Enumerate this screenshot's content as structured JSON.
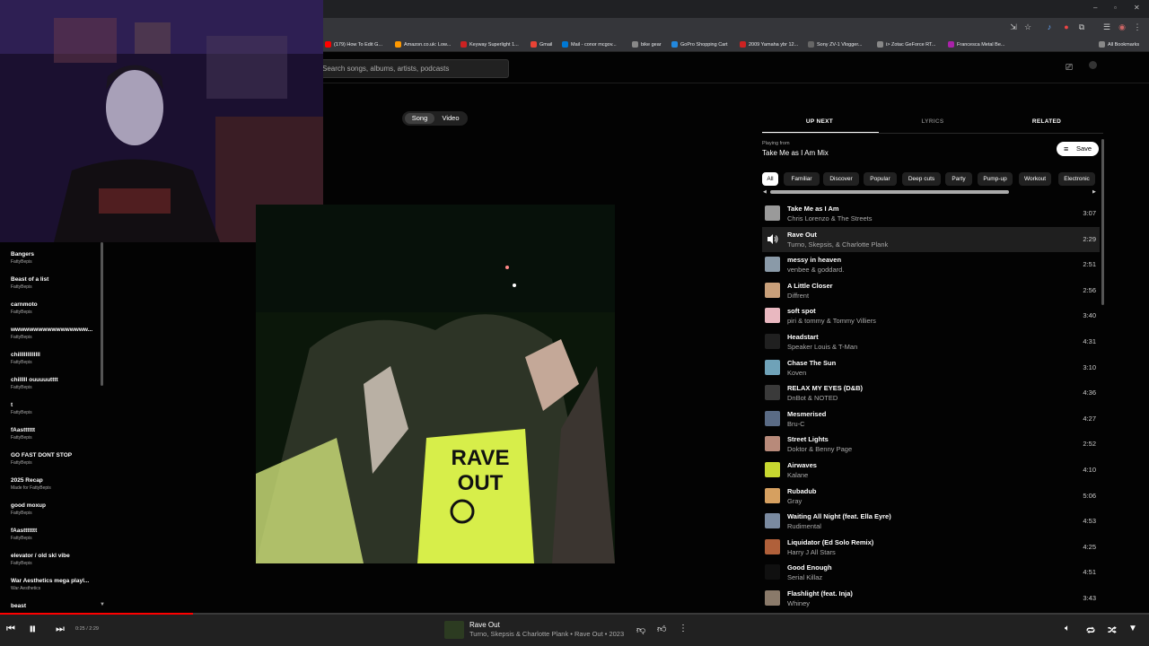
{
  "bookmarks": [
    {
      "label": "(179) How To Edit G...",
      "color": "#ff0000"
    },
    {
      "label": "Amazon.co.uk: Low...",
      "color": "#ff9900"
    },
    {
      "label": "Keyway Superlight 1...",
      "color": "#cc2222"
    },
    {
      "label": "Gmail",
      "color": "#ea4335"
    },
    {
      "label": "Mail - conor mcgov...",
      "color": "#0078d4"
    },
    {
      "label": "bike gear",
      "color": "#888888"
    },
    {
      "label": "GoPro Shopping Cart",
      "color": "#2288dd"
    },
    {
      "label": "2009 Yamaha ybr 12...",
      "color": "#cc2222"
    },
    {
      "label": "Sony ZV-1 Vlogger...",
      "color": "#666666"
    },
    {
      "label": "i> Zotac GeForce RT...",
      "color": "#888888"
    },
    {
      "label": "Francesca Metal Be...",
      "color": "#aa22aa"
    },
    {
      "label": "All Bookmarks",
      "color": "#888888"
    }
  ],
  "search": {
    "placeholder": "Search songs, albums, artists, podcasts"
  },
  "sidebar": {
    "playlists": [
      {
        "title": "Bangers",
        "sub": "FattyBepis"
      },
      {
        "title": "Beast of a list",
        "sub": "FattyBepis"
      },
      {
        "title": "carnmoto",
        "sub": "FattyBepis"
      },
      {
        "title": "wwwwwwwwwwwwwwwww...",
        "sub": "FattyBepis"
      },
      {
        "title": "chilllllllllllll",
        "sub": "FattyBepis"
      },
      {
        "title": "chilllll ouuuuutttt",
        "sub": "FattyBepis"
      },
      {
        "title": "t",
        "sub": "FattyBepis"
      },
      {
        "title": "fAastttttt",
        "sub": "FattyBepis"
      },
      {
        "title": "GO FAST DONT STOP",
        "sub": "FattyBepis"
      },
      {
        "title": "2025 Recap",
        "sub": "Made for FattyBepis"
      },
      {
        "title": "good moxup",
        "sub": "FattyBepis"
      },
      {
        "title": "fAasttttttt",
        "sub": "FattyBepis"
      },
      {
        "title": "elevator / old skl vibe",
        "sub": "FattyBepis"
      },
      {
        "title": "War Aesthetics mega playl...",
        "sub": "War Aesthetics"
      },
      {
        "title": "beast",
        "sub": ""
      }
    ]
  },
  "toggle": {
    "song": "Song",
    "video": "Video"
  },
  "art": {
    "sign_line1": "RAVE",
    "sign_line2": "OUT"
  },
  "panel": {
    "tabs": [
      "UP NEXT",
      "LYRICS",
      "RELATED"
    ],
    "playing_from": "Playing from",
    "mix_name": "Take Me as I Am Mix",
    "save_label": "Save",
    "chips": [
      "All",
      "Familiar",
      "Discover",
      "Popular",
      "Deep cuts",
      "Party",
      "Pump-up",
      "Workout",
      "Electronic"
    ],
    "queue": [
      {
        "title": "Take Me as I Am",
        "artist": "Chris Lorenzo & The Streets",
        "duration": "3:07",
        "color": "#9a9a9a"
      },
      {
        "title": "Rave Out",
        "artist": "Turno, Skepsis, & Charlotte Plank",
        "duration": "2:29",
        "color": "#2c3b21"
      },
      {
        "title": "messy in heaven",
        "artist": "venbee & goddard.",
        "duration": "2:51",
        "color": "#8a9aa8"
      },
      {
        "title": "A Little Closer",
        "artist": "Diffrent",
        "duration": "2:56",
        "color": "#c9a07a"
      },
      {
        "title": "soft spot",
        "artist": "piri & tommy & Tommy Villiers",
        "duration": "3:40",
        "color": "#e9b8c0"
      },
      {
        "title": "Headstart",
        "artist": "Speaker Louis & T-Man",
        "duration": "4:31",
        "color": "#202020"
      },
      {
        "title": "Chase The Sun",
        "artist": "Koven",
        "duration": "3:10",
        "color": "#6fa2b8"
      },
      {
        "title": "RELAX MY EYES (D&B)",
        "artist": "DnBot & NOTED",
        "duration": "4:36",
        "color": "#3a3a3a"
      },
      {
        "title": "Mesmerised",
        "artist": "Bru-C",
        "duration": "4:27",
        "color": "#5a6b85"
      },
      {
        "title": "Street Lights",
        "artist": "Doktor & Benny Page",
        "duration": "2:52",
        "color": "#b88a7a"
      },
      {
        "title": "Airwaves",
        "artist": "Kalane",
        "duration": "4:10",
        "color": "#c8d830"
      },
      {
        "title": "Rubadub",
        "artist": "Gray",
        "duration": "5:06",
        "color": "#d6a060"
      },
      {
        "title": "Waiting All Night (feat. Ella Eyre)",
        "artist": "Rudimental",
        "duration": "4:53",
        "color": "#7a8aa0"
      },
      {
        "title": "Liquidator (Ed Solo Remix)",
        "artist": "Harry J All Stars",
        "duration": "4:25",
        "color": "#b0603a"
      },
      {
        "title": "Good Enough",
        "artist": "Serial Killaz",
        "duration": "4:51",
        "color": "#101010"
      },
      {
        "title": "Flashlight (feat. Inja)",
        "artist": "Whiney",
        "duration": "3:43",
        "color": "#8a7a6a"
      }
    ]
  },
  "player": {
    "time": "0:25 / 2:29",
    "progress": 0.168,
    "title": "Rave Out",
    "meta": "Turno, Skepsis & Charlotte Plank • Rave Out • 2023"
  }
}
